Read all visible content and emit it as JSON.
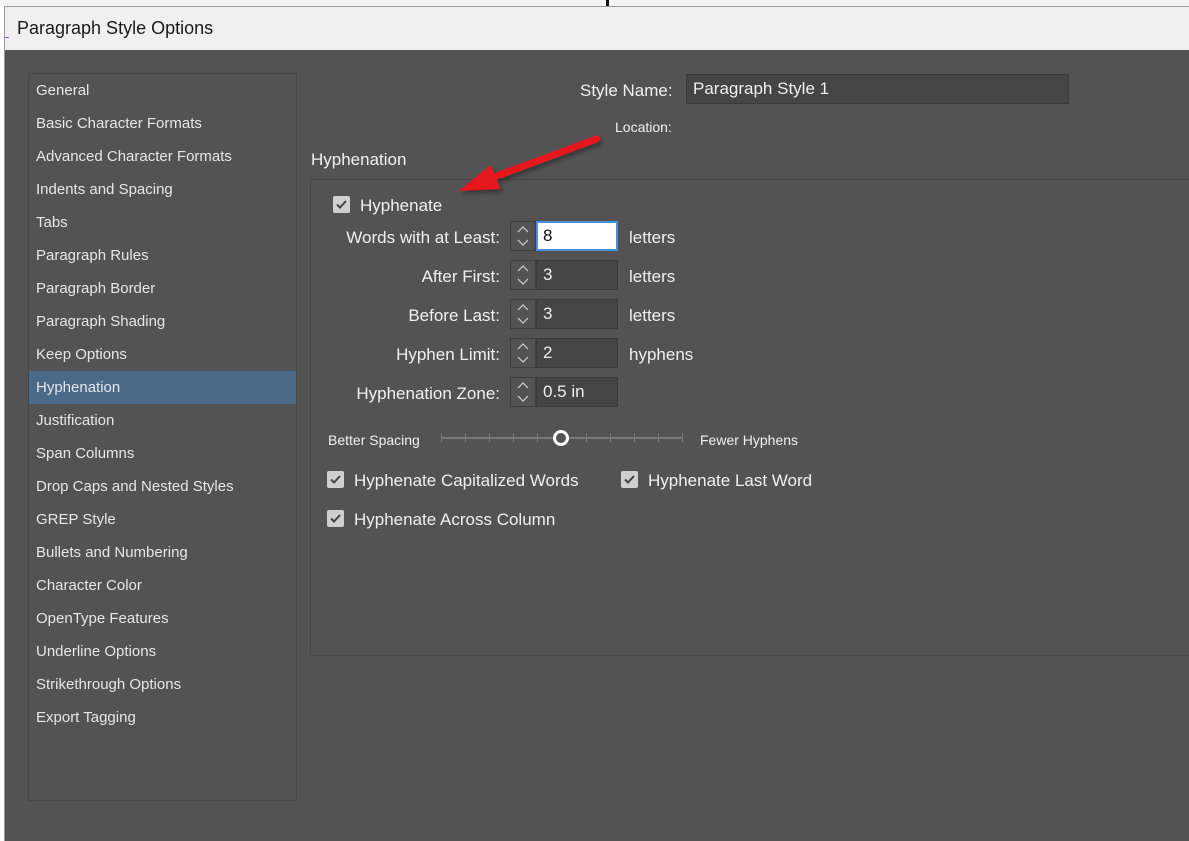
{
  "window": {
    "title": "Paragraph Style Options"
  },
  "sidebar": {
    "items": [
      {
        "label": "General",
        "selected": false
      },
      {
        "label": "Basic Character Formats",
        "selected": false
      },
      {
        "label": "Advanced Character Formats",
        "selected": false
      },
      {
        "label": "Indents and Spacing",
        "selected": false
      },
      {
        "label": "Tabs",
        "selected": false
      },
      {
        "label": "Paragraph Rules",
        "selected": false
      },
      {
        "label": "Paragraph Border",
        "selected": false
      },
      {
        "label": "Paragraph Shading",
        "selected": false
      },
      {
        "label": "Keep Options",
        "selected": false
      },
      {
        "label": "Hyphenation",
        "selected": true
      },
      {
        "label": "Justification",
        "selected": false
      },
      {
        "label": "Span Columns",
        "selected": false
      },
      {
        "label": "Drop Caps and Nested Styles",
        "selected": false
      },
      {
        "label": "GREP Style",
        "selected": false
      },
      {
        "label": "Bullets and Numbering",
        "selected": false
      },
      {
        "label": "Character Color",
        "selected": false
      },
      {
        "label": "OpenType Features",
        "selected": false
      },
      {
        "label": "Underline Options",
        "selected": false
      },
      {
        "label": "Strikethrough Options",
        "selected": false
      },
      {
        "label": "Export Tagging",
        "selected": false
      }
    ]
  },
  "style_name": {
    "label": "Style Name:",
    "value": "Paragraph Style 1"
  },
  "location": {
    "label": "Location:"
  },
  "section": {
    "title": "Hyphenation"
  },
  "hyphenate": {
    "label": "Hyphenate",
    "checked": true
  },
  "fields": [
    {
      "label": "Words with at Least:",
      "value": "8",
      "unit": "letters",
      "focused": true
    },
    {
      "label": "After First:",
      "value": "3",
      "unit": "letters",
      "focused": false
    },
    {
      "label": "Before Last:",
      "value": "3",
      "unit": "letters",
      "focused": false
    },
    {
      "label": "Hyphen Limit:",
      "value": "2",
      "unit": "hyphens",
      "focused": false
    },
    {
      "label": "Hyphenation Zone:",
      "value": "0.5 in",
      "unit": "",
      "focused": false
    }
  ],
  "slider": {
    "left_label": "Better Spacing",
    "right_label": "Fewer Hyphens",
    "position": 0.5,
    "ticks": 11
  },
  "options": {
    "capitalized": {
      "label": "Hyphenate Capitalized Words",
      "checked": true
    },
    "last_word": {
      "label": "Hyphenate Last Word",
      "checked": true
    },
    "across_column": {
      "label": "Hyphenate Across Column",
      "checked": true
    }
  },
  "colors": {
    "panel": "#535353",
    "selected": "#4a6a8a",
    "annotation_arrow": "#e5141b",
    "focus": "#4a90d9"
  },
  "annotation": {
    "icon": "red-arrow-icon"
  }
}
